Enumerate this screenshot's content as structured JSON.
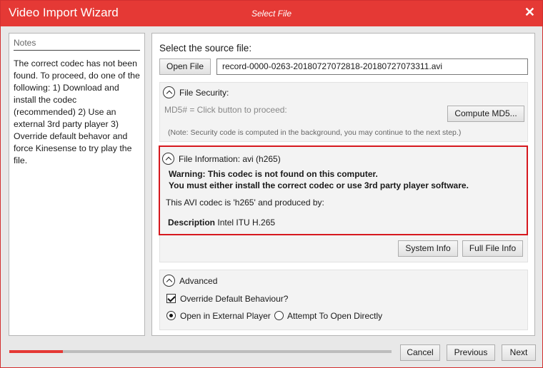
{
  "window": {
    "title": "Video Import Wizard",
    "subtitle": "Select File",
    "close_glyph": "✕"
  },
  "notes": {
    "title": "Notes",
    "text": "The correct codec has not been found. To proceed, do one of the following: 1) Download and install the codec (recommended) 2) Use an external 3rd party player 3) Override default  behavor and force Kinesense to try play the file."
  },
  "source": {
    "label": "Select the source file:",
    "open_button": "Open File",
    "file_value": "record-0000-0263-20180727072818-20180727073311.avi"
  },
  "security": {
    "header": "File Security:",
    "md5_text": "MD5# = Click button to proceed:",
    "compute_button": "Compute MD5...",
    "note": "(Note: Security code is computed in the background, you may continue to the next step.)"
  },
  "file_info": {
    "header": "File Information: avi (h265)",
    "warning_line1": "Warning: This codec is not found on this computer.",
    "warning_line2": "You must either install the correct codec or use 3rd party player software.",
    "codec_text": "This AVI codec is 'h265' and produced by:",
    "description_label": "Description",
    "description_value": "Intel ITU H.265",
    "system_info_button": "System Info",
    "full_file_info_button": "Full File Info"
  },
  "advanced": {
    "header": "Advanced",
    "override_label": "Override Default Behaviour?",
    "override_checked": true,
    "radio_external": "Open in External Player",
    "radio_direct": "Attempt To Open Directly",
    "selected": "external"
  },
  "footer": {
    "progress": 0.14,
    "cancel": "Cancel",
    "previous": "Previous",
    "next": "Next"
  },
  "colors": {
    "accent": "#e53935",
    "highlight_border": "#d6181e"
  }
}
